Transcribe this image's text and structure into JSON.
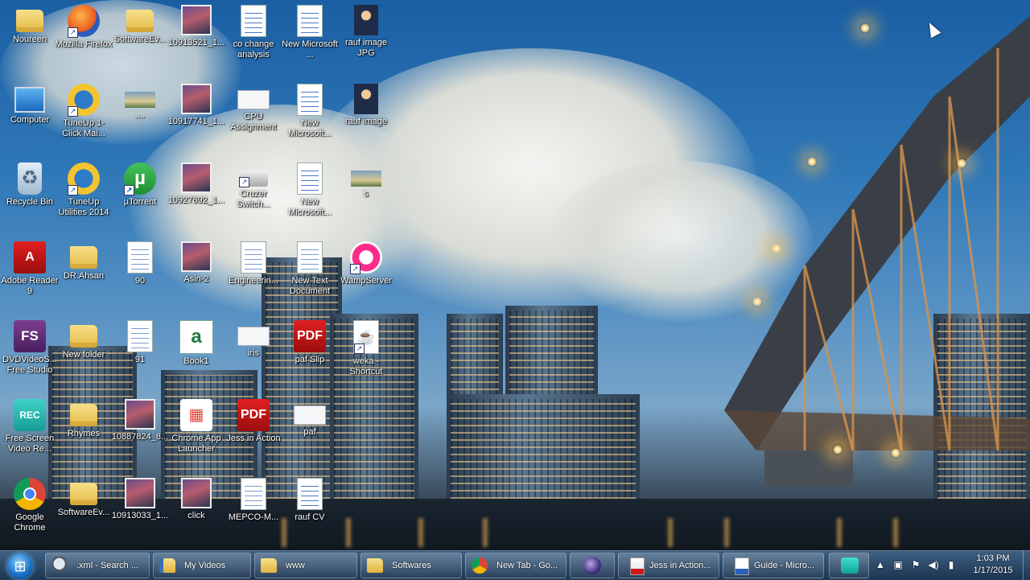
{
  "desktop": {
    "icons": [
      {
        "label": "Noureen",
        "icon": "user-folder-icon"
      },
      {
        "label": "Mozilla Firefox",
        "icon": "firefox-icon"
      },
      {
        "label": "SoftwareEv...",
        "icon": "folder-icon"
      },
      {
        "label": "10913521_1...",
        "icon": "photo-icon"
      },
      {
        "label": "co change analysis",
        "icon": "word-document-icon"
      },
      {
        "label": "New Microsoft ...",
        "icon": "word-document-icon"
      },
      {
        "label": "rauf image JPG",
        "icon": "photo-icon"
      },
      {
        "label": "Computer",
        "icon": "computer-icon"
      },
      {
        "label": "TuneUp 1-Click Mai...",
        "icon": "tuneup-icon"
      },
      {
        "label": "....",
        "icon": "image-thumbnail-icon"
      },
      {
        "label": "10917741_1...",
        "icon": "photo-icon"
      },
      {
        "label": "CPU Assignment",
        "icon": "document-icon"
      },
      {
        "label": "New Microsoft...",
        "icon": "word-document-icon"
      },
      {
        "label": "rauf image",
        "icon": "photo-icon"
      },
      {
        "label": "Recycle Bin",
        "icon": "recycle-bin-icon"
      },
      {
        "label": "TuneUp Utilities 2014",
        "icon": "tuneup-icon"
      },
      {
        "label": "µTorrent",
        "icon": "utorrent-icon"
      },
      {
        "label": "10927892_1...",
        "icon": "photo-icon"
      },
      {
        "label": "Cruzer Switch...",
        "icon": "usb-drive-icon"
      },
      {
        "label": "New Microsoft...",
        "icon": "word-document-icon"
      },
      {
        "label": "s",
        "icon": "image-thumbnail-icon"
      },
      {
        "label": "Adobe Reader 9",
        "icon": "adobe-reader-icon"
      },
      {
        "label": "DR.Ahsan",
        "icon": "folder-icon"
      },
      {
        "label": "90",
        "icon": "document-icon"
      },
      {
        "label": "Asin-2",
        "icon": "photo-icon"
      },
      {
        "label": "Engineerin...",
        "icon": "document-icon"
      },
      {
        "label": "New Text Document",
        "icon": "text-document-icon"
      },
      {
        "label": "WampServer",
        "icon": "wampserver-icon"
      },
      {
        "label": "DVDVideoS... Free Studio",
        "icon": "free-studio-icon"
      },
      {
        "label": "New folder",
        "icon": "folder-icon"
      },
      {
        "label": "91",
        "icon": "document-icon"
      },
      {
        "label": "Book1",
        "icon": "excel-document-icon"
      },
      {
        "label": "iris",
        "icon": "document-icon"
      },
      {
        "label": "paf Slip",
        "icon": "pdf-icon"
      },
      {
        "label": "weka - Shortcut",
        "icon": "java-icon"
      },
      {
        "label": "Free Screen Video Re...",
        "icon": "screen-recorder-icon"
      },
      {
        "label": "Rhymes",
        "icon": "folder-icon"
      },
      {
        "label": "10887824_8...",
        "icon": "photo-icon"
      },
      {
        "label": "Chrome App Launcher",
        "icon": "chrome-app-launcher-icon"
      },
      {
        "label": "Jess in Action",
        "icon": "pdf-icon"
      },
      {
        "label": "paf",
        "icon": "image-thumbnail-icon"
      },
      {
        "label": "Google Chrome",
        "icon": "chrome-icon"
      },
      {
        "label": "SoftwareEv...",
        "icon": "folder-icon"
      },
      {
        "label": "10913033_1...",
        "icon": "photo-icon"
      },
      {
        "label": "click",
        "icon": "photo-icon"
      },
      {
        "label": "MEPCO-M...",
        "icon": "document-icon"
      },
      {
        "label": "rauf CV",
        "icon": "word-document-icon"
      }
    ]
  },
  "taskbar": {
    "start_icon": "windows-start-orb-icon",
    "buttons": [
      {
        "label": ".xml - Search ...",
        "icon": "search-icon"
      },
      {
        "label": "My Videos",
        "icon": "folder-icon"
      },
      {
        "label": "www",
        "icon": "folder-icon"
      },
      {
        "label": "Softwares",
        "icon": "folder-icon"
      },
      {
        "label": "New Tab - Go...",
        "icon": "chrome-icon"
      },
      {
        "label": "",
        "icon": "eclipse-icon"
      },
      {
        "label": "Jess in Action...",
        "icon": "pdf-icon"
      },
      {
        "label": "Guide - Micro...",
        "icon": "word-document-icon"
      }
    ],
    "tray": {
      "icons": [
        "screen-recorder-icon",
        "show-hidden-icons-icon",
        "network-icon",
        "action-center-flag-icon",
        "volume-icon",
        "signal-icon"
      ]
    },
    "clock": {
      "time": "1:03 PM",
      "date": "1/17/2015"
    }
  },
  "colors": {
    "taskbar": "#2e4f72",
    "label_text": "#ffffff",
    "wallpaper_sky": "#2f78b8"
  }
}
